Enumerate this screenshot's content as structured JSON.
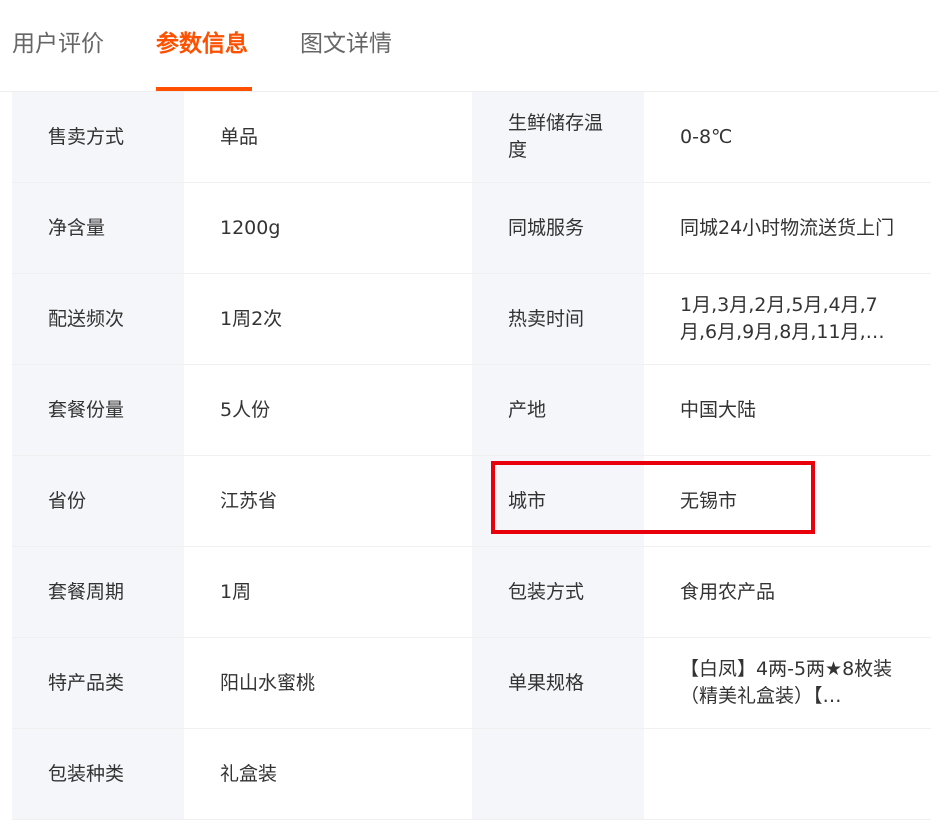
{
  "tabs": [
    {
      "label": "用户评价",
      "active": false
    },
    {
      "label": "参数信息",
      "active": true
    },
    {
      "label": "图文详情",
      "active": false
    }
  ],
  "params": [
    {
      "k1": "售卖方式",
      "v1": "单品",
      "k2": "生鲜储存温度",
      "v2": "0-8℃"
    },
    {
      "k1": "净含量",
      "v1": "1200g",
      "k2": "同城服务",
      "v2": "同城24小时物流送货上门"
    },
    {
      "k1": "配送频次",
      "v1": "1周2次",
      "k2": "热卖时间",
      "v2": "1月,3月,2月,5月,4月,7月,6月,9月,8月,11月,…"
    },
    {
      "k1": "套餐份量",
      "v1": "5人份",
      "k2": "产地",
      "v2": "中国大陆"
    },
    {
      "k1": "省份",
      "v1": "江苏省",
      "k2": "城市",
      "v2": "无锡市"
    },
    {
      "k1": "套餐周期",
      "v1": "1周",
      "k2": "包装方式",
      "v2": "食用农产品"
    },
    {
      "k1": "特产品类",
      "v1": "阳山水蜜桃",
      "k2": "单果规格",
      "v2": "【白凤】4两-5两★8枚装（精美礼盒装）【…"
    },
    {
      "k1": "包装种类",
      "v1": "礼盒装",
      "k2": "",
      "v2": ""
    }
  ],
  "colors": {
    "accent": "#ff5000",
    "highlight_border": "#e8000b",
    "key_cell_bg": "#f4f6f9"
  }
}
